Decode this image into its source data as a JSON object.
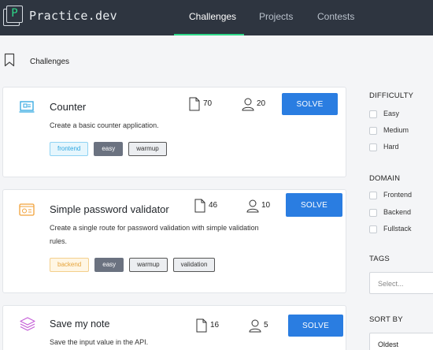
{
  "app": {
    "logo_letter": "P",
    "brand": "Practice.dev"
  },
  "nav": {
    "tabs": [
      "Challenges",
      "Projects",
      "Contests"
    ],
    "active": "Challenges"
  },
  "breadcrumb": {
    "label": "Challenges"
  },
  "challenges": [
    {
      "title": "Counter",
      "description": "Create a basic counter application.",
      "files": "70",
      "users": "20",
      "solve_label": "SOLVE",
      "tags": [
        "frontend",
        "easy",
        "warmup"
      ],
      "icon": "monitor-icon"
    },
    {
      "title": "Simple password validator",
      "description": "Create a single route for password validation with simple validation rules.",
      "files": "46",
      "users": "10",
      "solve_label": "SOLVE",
      "tags": [
        "backend",
        "easy",
        "warmup",
        "validation"
      ],
      "icon": "server-icon"
    },
    {
      "title": "Save my note",
      "description": "Save the input value in the API.",
      "files": "16",
      "users": "5",
      "solve_label": "SOLVE",
      "tags": [],
      "icon": "layers-icon"
    }
  ],
  "sidebar": {
    "difficulty": {
      "title": "DIFFICULTY",
      "options": [
        "Easy",
        "Medium",
        "Hard"
      ]
    },
    "domain": {
      "title": "DOMAIN",
      "options": [
        "Frontend",
        "Backend",
        "Fullstack"
      ]
    },
    "tags": {
      "title": "TAGS",
      "placeholder": "Select..."
    },
    "sort": {
      "title": "SORT BY",
      "value": "Oldest"
    }
  },
  "colors": {
    "topbar": "#2e3540",
    "accent": "#2ed889",
    "solve_button": "#2a7de1",
    "frontend_tag": "#2ea6e0",
    "backend_tag": "#e6a43b",
    "counter_icon": "#2ea6e0",
    "password_icon": "#f2a23a",
    "note_icon": "#c660d8"
  }
}
